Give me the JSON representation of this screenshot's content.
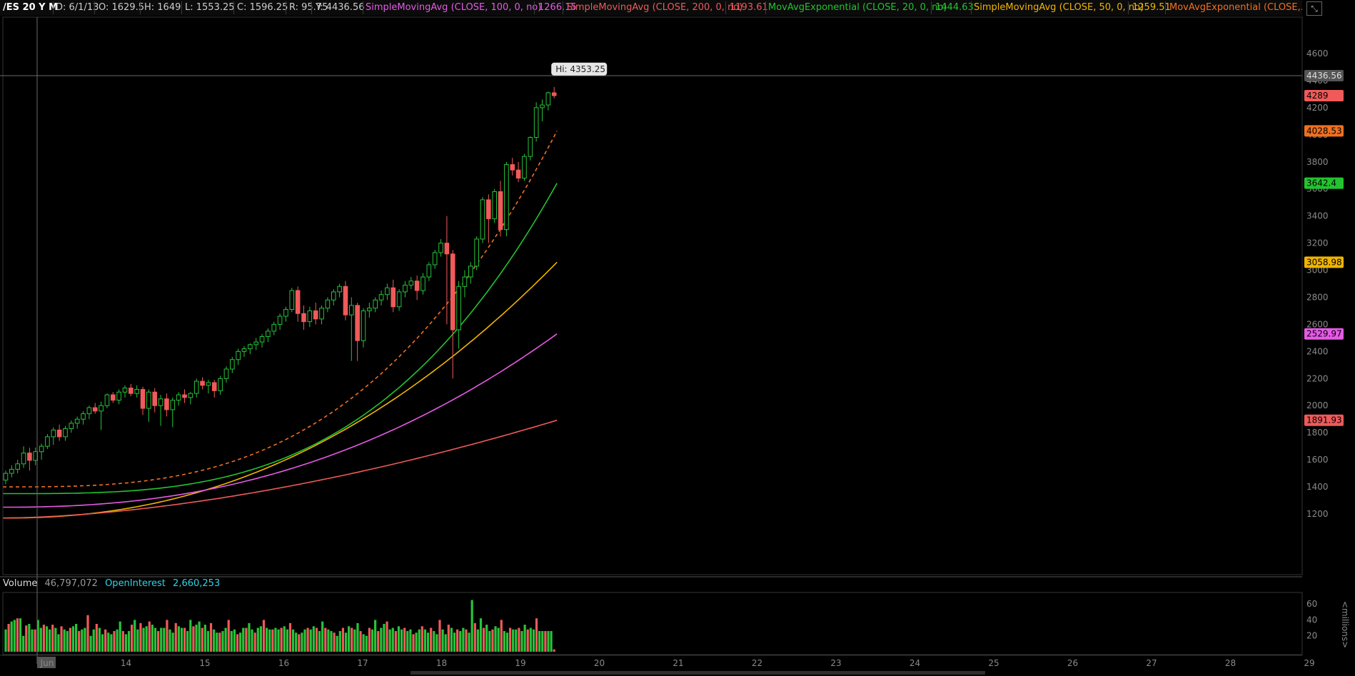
{
  "header": {
    "symbol": "/ES 20 Y M",
    "date": "D: 6/1/13",
    "open": "O: 1629.5",
    "high": "H: 1649",
    "low": "L: 1553.25",
    "close": "C: 1596.25",
    "range": "R: 95.75",
    "y": "Y: 4436.56",
    "studies": [
      {
        "label": "SimpleMovingAvg (CLOSE, 100, 0, no)",
        "value": "1266.15",
        "color": "#e65ae6"
      },
      {
        "label": "SimpleMovingAvg (CLOSE, 200, 0, no)",
        "value": "1193.61",
        "color": "#ee5a5a"
      },
      {
        "label": "MovAvgExponential (CLOSE, 20, 0, no)",
        "value": "1444.63",
        "color": "#22c32e"
      },
      {
        "label": "SimpleMovingAvg (CLOSE, 50, 0, no)",
        "value": "1259.51",
        "color": "#f0b400"
      },
      {
        "label": "MovAvgExponential (CLOSE,...",
        "value": "",
        "color": "#f07020"
      }
    ]
  },
  "volume_header": {
    "label": "Volume",
    "value": "46,797,072",
    "oi_label": "OpenInterest",
    "oi_value": "2,660,253"
  },
  "colors": {
    "up": "#26c43a",
    "down": "#f05a5a",
    "sma100": "#e65ae6",
    "sma200": "#ee5a5a",
    "ema20": "#22c32e",
    "sma50": "#f0b400",
    "ema_fast": "#f07020"
  },
  "chart_data": [
    {
      "type": "candlestick",
      "title": "/ES 20 Y M",
      "x": [
        "Jun",
        "14",
        "15",
        "16",
        "17",
        "18",
        "19",
        "20",
        "21",
        "22",
        "23",
        "24",
        "25",
        "26",
        "27",
        "28",
        "29"
      ],
      "ylim": [
        1100,
        4700
      ],
      "yticks": [
        1200,
        1400,
        1600,
        1800,
        2000,
        2200,
        2400,
        2600,
        2800,
        3000,
        3200,
        3400,
        3600,
        3800,
        4000,
        4200,
        4400,
        4600
      ],
      "candles": [
        {
          "o": 1450,
          "h": 1520,
          "l": 1420,
          "c": 1500
        },
        {
          "o": 1500,
          "h": 1560,
          "l": 1470,
          "c": 1530
        },
        {
          "o": 1530,
          "h": 1600,
          "l": 1500,
          "c": 1570
        },
        {
          "o": 1570,
          "h": 1700,
          "l": 1540,
          "c": 1650
        },
        {
          "o": 1650,
          "h": 1690,
          "l": 1520,
          "c": 1596
        },
        {
          "o": 1596,
          "h": 1690,
          "l": 1560,
          "c": 1660
        },
        {
          "o": 1660,
          "h": 1720,
          "l": 1600,
          "c": 1700
        },
        {
          "o": 1700,
          "h": 1790,
          "l": 1680,
          "c": 1770
        },
        {
          "o": 1770,
          "h": 1840,
          "l": 1710,
          "c": 1820
        },
        {
          "o": 1820,
          "h": 1860,
          "l": 1740,
          "c": 1770
        },
        {
          "o": 1770,
          "h": 1850,
          "l": 1740,
          "c": 1830
        },
        {
          "o": 1830,
          "h": 1890,
          "l": 1800,
          "c": 1870
        },
        {
          "o": 1870,
          "h": 1920,
          "l": 1830,
          "c": 1900
        },
        {
          "o": 1900,
          "h": 1960,
          "l": 1860,
          "c": 1940
        },
        {
          "o": 1940,
          "h": 2000,
          "l": 1900,
          "c": 1985
        },
        {
          "o": 1985,
          "h": 2020,
          "l": 1940,
          "c": 1960
        },
        {
          "o": 1960,
          "h": 2030,
          "l": 1820,
          "c": 2000
        },
        {
          "o": 2000,
          "h": 2090,
          "l": 1980,
          "c": 2080
        },
        {
          "o": 2080,
          "h": 2100,
          "l": 2020,
          "c": 2040
        },
        {
          "o": 2040,
          "h": 2120,
          "l": 2010,
          "c": 2100
        },
        {
          "o": 2100,
          "h": 2150,
          "l": 2060,
          "c": 2130
        },
        {
          "o": 2130,
          "h": 2160,
          "l": 2070,
          "c": 2090
        },
        {
          "o": 2090,
          "h": 2150,
          "l": 2060,
          "c": 2120
        },
        {
          "o": 2120,
          "h": 2140,
          "l": 1930,
          "c": 1980
        },
        {
          "o": 1980,
          "h": 2120,
          "l": 1880,
          "c": 2100
        },
        {
          "o": 2100,
          "h": 2130,
          "l": 1950,
          "c": 2000
        },
        {
          "o": 2000,
          "h": 2080,
          "l": 1850,
          "c": 2050
        },
        {
          "o": 2050,
          "h": 2090,
          "l": 1920,
          "c": 1970
        },
        {
          "o": 1970,
          "h": 2060,
          "l": 1840,
          "c": 2040
        },
        {
          "o": 2040,
          "h": 2100,
          "l": 2000,
          "c": 2080
        },
        {
          "o": 2080,
          "h": 2120,
          "l": 2020,
          "c": 2060
        },
        {
          "o": 2060,
          "h": 2100,
          "l": 2010,
          "c": 2090
        },
        {
          "o": 2090,
          "h": 2200,
          "l": 2060,
          "c": 2180
        },
        {
          "o": 2180,
          "h": 2210,
          "l": 2120,
          "c": 2150
        },
        {
          "o": 2150,
          "h": 2190,
          "l": 2090,
          "c": 2170
        },
        {
          "o": 2170,
          "h": 2190,
          "l": 2060,
          "c": 2110
        },
        {
          "o": 2110,
          "h": 2220,
          "l": 2080,
          "c": 2200
        },
        {
          "o": 2200,
          "h": 2290,
          "l": 2170,
          "c": 2270
        },
        {
          "o": 2270,
          "h": 2360,
          "l": 2240,
          "c": 2340
        },
        {
          "o": 2340,
          "h": 2420,
          "l": 2300,
          "c": 2400
        },
        {
          "o": 2400,
          "h": 2440,
          "l": 2360,
          "c": 2420
        },
        {
          "o": 2420,
          "h": 2460,
          "l": 2380,
          "c": 2450
        },
        {
          "o": 2450,
          "h": 2500,
          "l": 2410,
          "c": 2470
        },
        {
          "o": 2470,
          "h": 2530,
          "l": 2430,
          "c": 2510
        },
        {
          "o": 2510,
          "h": 2570,
          "l": 2470,
          "c": 2550
        },
        {
          "o": 2550,
          "h": 2620,
          "l": 2520,
          "c": 2600
        },
        {
          "o": 2600,
          "h": 2680,
          "l": 2560,
          "c": 2660
        },
        {
          "o": 2660,
          "h": 2730,
          "l": 2620,
          "c": 2710
        },
        {
          "o": 2710,
          "h": 2870,
          "l": 2690,
          "c": 2850
        },
        {
          "o": 2850,
          "h": 2880,
          "l": 2620,
          "c": 2680
        },
        {
          "o": 2680,
          "h": 2740,
          "l": 2560,
          "c": 2620
        },
        {
          "o": 2620,
          "h": 2730,
          "l": 2580,
          "c": 2700
        },
        {
          "o": 2700,
          "h": 2760,
          "l": 2600,
          "c": 2640
        },
        {
          "o": 2640,
          "h": 2740,
          "l": 2600,
          "c": 2720
        },
        {
          "o": 2720,
          "h": 2800,
          "l": 2690,
          "c": 2780
        },
        {
          "o": 2780,
          "h": 2860,
          "l": 2740,
          "c": 2840
        },
        {
          "o": 2840,
          "h": 2900,
          "l": 2800,
          "c": 2880
        },
        {
          "o": 2880,
          "h": 2920,
          "l": 2630,
          "c": 2670
        },
        {
          "o": 2670,
          "h": 2800,
          "l": 2330,
          "c": 2740
        },
        {
          "o": 2740,
          "h": 2760,
          "l": 2330,
          "c": 2480
        },
        {
          "o": 2480,
          "h": 2720,
          "l": 2430,
          "c": 2700
        },
        {
          "o": 2700,
          "h": 2760,
          "l": 2650,
          "c": 2720
        },
        {
          "o": 2720,
          "h": 2800,
          "l": 2690,
          "c": 2780
        },
        {
          "o": 2780,
          "h": 2850,
          "l": 2740,
          "c": 2820
        },
        {
          "o": 2820,
          "h": 2900,
          "l": 2780,
          "c": 2870
        },
        {
          "o": 2870,
          "h": 2930,
          "l": 2690,
          "c": 2730
        },
        {
          "o": 2730,
          "h": 2860,
          "l": 2700,
          "c": 2840
        },
        {
          "o": 2840,
          "h": 2920,
          "l": 2800,
          "c": 2890
        },
        {
          "o": 2890,
          "h": 2950,
          "l": 2860,
          "c": 2920
        },
        {
          "o": 2920,
          "h": 2960,
          "l": 2780,
          "c": 2850
        },
        {
          "o": 2850,
          "h": 2980,
          "l": 2820,
          "c": 2950
        },
        {
          "o": 2950,
          "h": 3060,
          "l": 2920,
          "c": 3040
        },
        {
          "o": 3040,
          "h": 3150,
          "l": 3010,
          "c": 3130
        },
        {
          "o": 3130,
          "h": 3230,
          "l": 3100,
          "c": 3200
        },
        {
          "o": 3200,
          "h": 3400,
          "l": 2600,
          "c": 3120
        },
        {
          "o": 3120,
          "h": 3150,
          "l": 2200,
          "c": 2560
        },
        {
          "o": 2560,
          "h": 2920,
          "l": 2420,
          "c": 2880
        },
        {
          "o": 2880,
          "h": 3000,
          "l": 2800,
          "c": 2950
        },
        {
          "o": 2950,
          "h": 3060,
          "l": 2900,
          "c": 3030
        },
        {
          "o": 3030,
          "h": 3250,
          "l": 3000,
          "c": 3230
        },
        {
          "o": 3230,
          "h": 3540,
          "l": 3200,
          "c": 3520
        },
        {
          "o": 3520,
          "h": 3560,
          "l": 3200,
          "c": 3380
        },
        {
          "o": 3380,
          "h": 3600,
          "l": 3350,
          "c": 3580
        },
        {
          "o": 3580,
          "h": 3660,
          "l": 3250,
          "c": 3300
        },
        {
          "o": 3300,
          "h": 3800,
          "l": 3250,
          "c": 3780
        },
        {
          "o": 3780,
          "h": 3830,
          "l": 3700,
          "c": 3740
        },
        {
          "o": 3740,
          "h": 3800,
          "l": 3650,
          "c": 3680
        },
        {
          "o": 3680,
          "h": 3860,
          "l": 3660,
          "c": 3840
        },
        {
          "o": 3840,
          "h": 3990,
          "l": 3810,
          "c": 3980
        },
        {
          "o": 3980,
          "h": 4240,
          "l": 3950,
          "c": 4200
        },
        {
          "o": 4200,
          "h": 4260,
          "l": 4100,
          "c": 4220
        },
        {
          "o": 4220,
          "h": 4320,
          "l": 4180,
          "c": 4310
        },
        {
          "o": 4310,
          "h": 4353.25,
          "l": 4270,
          "c": 4289
        }
      ],
      "series": [
        {
          "name": "MovAvgExponential (CLOSE,...",
          "style": "dashed",
          "color_key": "ema_fast",
          "start": 1400,
          "end": 4028.53,
          "power": 3.0
        },
        {
          "name": "MovAvgExponential (CLOSE, 20, 0, no)",
          "color_key": "ema20",
          "start": 1350,
          "end": 3642.4,
          "power": 3.2
        },
        {
          "name": "SimpleMovingAvg (CLOSE, 50, 0, no)",
          "color_key": "sma50",
          "start": 1170,
          "end": 3058.98,
          "power": 2.2
        },
        {
          "name": "SimpleMovingAvg (CLOSE, 100, 0, no)",
          "color_key": "sma100",
          "start": 1250,
          "end": 2529.97,
          "power": 2.3
        },
        {
          "name": "SimpleMovingAvg (CLOSE, 200, 0, no)",
          "color_key": "sma200",
          "start": 1170,
          "end": 1891.93,
          "power": 1.7
        }
      ],
      "price_tags": [
        {
          "label": "4436.56",
          "value": 4436.56,
          "color": "#555555",
          "text": "#dddddd"
        },
        {
          "label": "4289",
          "value": 4289,
          "color": "#f05a5a",
          "text": "#000000"
        },
        {
          "label": "4028.53",
          "value": 4028.53,
          "color": "#f07020",
          "text": "#000000"
        },
        {
          "label": "3642.4",
          "value": 3642.4,
          "color": "#22c32e",
          "text": "#000000"
        },
        {
          "label": "3058.98",
          "value": 3058.98,
          "color": "#f0b400",
          "text": "#000000"
        },
        {
          "label": "2529.97",
          "value": 2529.97,
          "color": "#e65ae6",
          "text": "#000000"
        },
        {
          "label": "1891.93",
          "value": 1891.93,
          "color": "#ee5a5a",
          "text": "#000000"
        }
      ],
      "hi_label": "Hi: 4353.25",
      "crosshair_y": 4436.56
    },
    {
      "type": "bar",
      "title": "Volume",
      "ylabel": "<millions>",
      "ylim": [
        0,
        70
      ],
      "yticks": [
        20,
        40,
        60
      ],
      "values": [
        28,
        35,
        38,
        40,
        42,
        42,
        20,
        33,
        35,
        28,
        28,
        40,
        30,
        34,
        32,
        28,
        34,
        30,
        22,
        32,
        28,
        26,
        30,
        32,
        35,
        26,
        28,
        30,
        46,
        20,
        28,
        35,
        30,
        22,
        28,
        24,
        22,
        26,
        28,
        38,
        26,
        22,
        26,
        34,
        40,
        28,
        36,
        30,
        32,
        38,
        34,
        30,
        26,
        30,
        30,
        40,
        28,
        24,
        36,
        32,
        30,
        30,
        26,
        40,
        32,
        34,
        38,
        30,
        34,
        26,
        36,
        28,
        24,
        24,
        26,
        30,
        40,
        26,
        28,
        22,
        24,
        30,
        30,
        36,
        28,
        24,
        30,
        32,
        40,
        30,
        28,
        28,
        30,
        28,
        30,
        32,
        28,
        36,
        28,
        24,
        22,
        24,
        28,
        30,
        28,
        32,
        30,
        26,
        38,
        30,
        28,
        26,
        24,
        20,
        26,
        30,
        24,
        32,
        30,
        28,
        36,
        26,
        22,
        20,
        30,
        28,
        40,
        26,
        30,
        35,
        38,
        28,
        30,
        26,
        32,
        28,
        30,
        26,
        28,
        22,
        24,
        28,
        32,
        28,
        24,
        30,
        26,
        22,
        40,
        28,
        22,
        34,
        30,
        24,
        28,
        26,
        30,
        28,
        24,
        65,
        36,
        28,
        42,
        30,
        34,
        26,
        28,
        32,
        30,
        40,
        26,
        24,
        30,
        28,
        28,
        30,
        26,
        34,
        28,
        30,
        28,
        42,
        26,
        26,
        26,
        26,
        26,
        3
      ],
      "colors_pattern": "mixed"
    }
  ]
}
